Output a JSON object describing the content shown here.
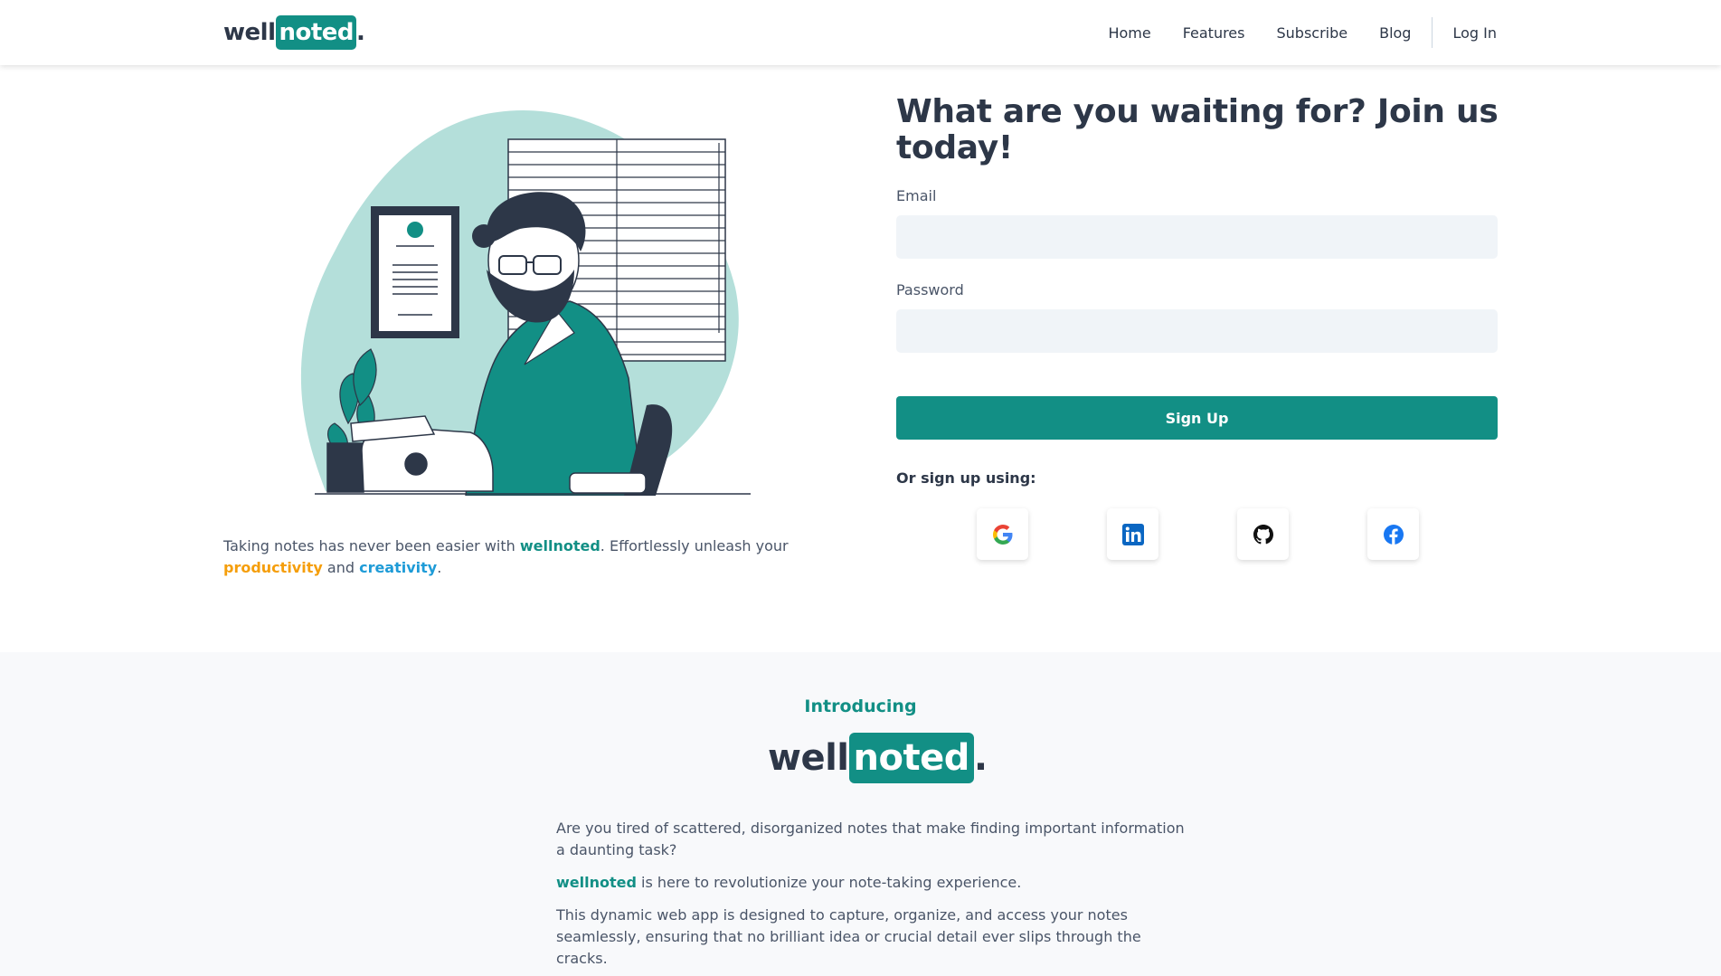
{
  "logo": {
    "part1": "well",
    "part2": "noted",
    "dot": "."
  },
  "nav": {
    "links": [
      "Home",
      "Features",
      "Subscribe",
      "Blog"
    ],
    "login": "Log In"
  },
  "hero": {
    "tagline": {
      "pre": "Taking notes has never been easier with ",
      "brand": "wellnoted",
      "mid": ". Effortlessly unleash your",
      "productivity": "productivity",
      "and": " and ",
      "creativity": "creativity",
      "end": "."
    }
  },
  "signup": {
    "title": "What are you waiting for? Join us today!",
    "email_label": "Email",
    "email_value": "",
    "password_label": "Password",
    "password_value": "",
    "button": "Sign Up",
    "alt_label": "Or sign up using:",
    "providers": [
      "google-icon",
      "linkedin-icon",
      "github-icon",
      "facebook-icon"
    ]
  },
  "intro": {
    "kicker": "Introducing",
    "p1": "Are you tired of scattered, disorganized notes that make finding important information a daunting task?",
    "p2_brand": "wellnoted",
    "p2_rest": " is here to revolutionize your note-taking experience.",
    "p3": "This dynamic web app is designed to capture, organize, and access your notes seamlessly, ensuring that no brilliant idea or crucial detail ever slips through the cracks."
  },
  "colors": {
    "brand": "#128f85",
    "text": "#2d3748",
    "productivity": "#f59e0b",
    "creativity": "#1e9bd7",
    "input_bg": "#f0f4f8",
    "section_bg": "#f8f9fb"
  }
}
